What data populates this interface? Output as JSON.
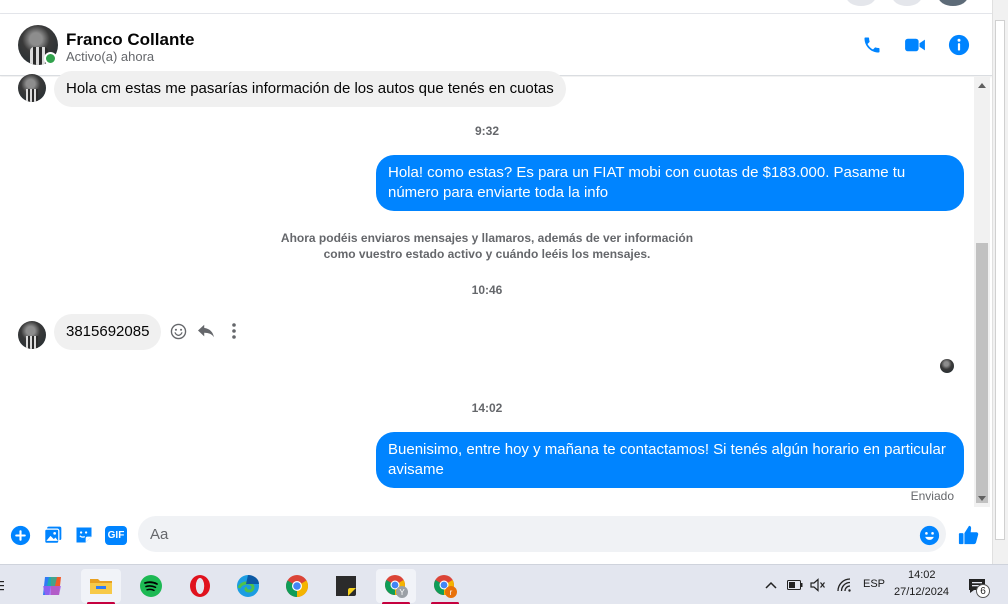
{
  "header": {
    "name": "Franco Collante",
    "status": "Activo(a) ahora"
  },
  "colors": {
    "accent": "#0084ff",
    "online": "#31a24c",
    "incoming_bubble": "#f0f0f0"
  },
  "messages": {
    "m1": "Hola cm estas me pasarías información de los autos que tenés en cuotas",
    "t1": "9:32",
    "m2": "Hola! como estas? Es para un FIAT mobi con cuotas de $183.000. Pasame tu número para enviarte toda la info",
    "system_note": "Ahora podéis enviaros mensajes y llamaros, además de ver información como vuestro estado activo y cuándo leéis los mensajes.",
    "t2": "10:46",
    "m3": "3815692085",
    "t3": "14:02",
    "m4": "Buenisimo, entre hoy y mañana te contactamos! Si tenés algún horario en particular avisame",
    "sent_status": "Enviado"
  },
  "composer": {
    "placeholder": "Aa",
    "gif_label": "GIF"
  },
  "taskbar": {
    "language": "ESP",
    "time": "14:02",
    "date": "27/12/2024",
    "notification_count": "6",
    "apps": [
      "copilot-icon",
      "file-explorer-icon",
      "spotify-icon",
      "opera-icon",
      "edge-icon",
      "chrome-icon",
      "sticky-notes-icon",
      "chrome-profile-y-icon",
      "chrome-profile-r-icon"
    ]
  }
}
